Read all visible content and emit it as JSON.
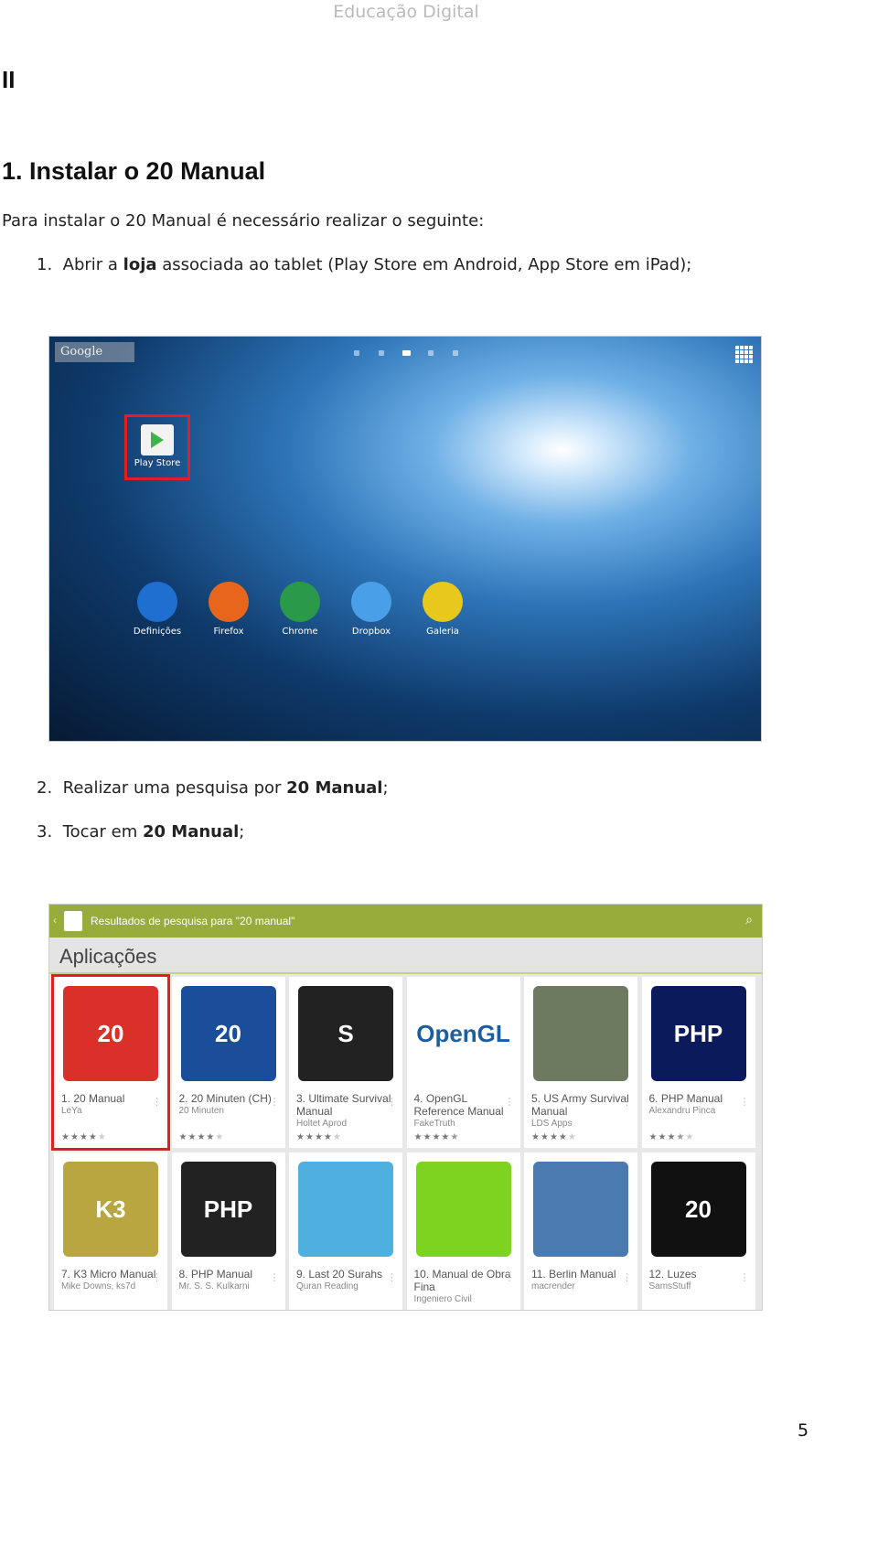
{
  "header": "Educação Digital",
  "section": "II",
  "title": "1. Instalar o 20 Manual",
  "intro": "Para instalar o 20 Manual é necessário realizar o seguinte:",
  "steps": [
    {
      "num": "1.",
      "pre": "Abrir a ",
      "bold": "loja",
      "post": " associada ao tablet (Play Store em Android, App Store em iPad);"
    },
    {
      "num": "2.",
      "pre": "Realizar uma pesquisa por ",
      "bold": "20 Manual",
      "post": ";"
    },
    {
      "num": "3.",
      "pre": "Tocar em ",
      "bold": "20 Manual",
      "post": ";"
    }
  ],
  "tablet": {
    "search": "Google",
    "highlight_color": "#e02020",
    "play_store": "Play Store",
    "apps": [
      {
        "label": "Definições",
        "color": "#1e6fd0"
      },
      {
        "label": "Firefox",
        "color": "#e8661c"
      },
      {
        "label": "Chrome",
        "color": "#2a9a4a"
      },
      {
        "label": "Dropbox",
        "color": "#4aa0e8"
      },
      {
        "label": "Galeria",
        "color": "#e8c81c"
      }
    ]
  },
  "store": {
    "bar_title": "Resultados de pesquisa para \"20 manual\"",
    "accent": "#97ac3a",
    "section": "Aplicações",
    "results": [
      {
        "title": "1. 20 Manual",
        "dev": "LeYa",
        "rating": 4,
        "icon": "20",
        "color": "#d9302a"
      },
      {
        "title": "2. 20 Minuten (CH)",
        "dev": "20 Minuten",
        "rating": 4,
        "icon": "20",
        "color": "#1a4e9a"
      },
      {
        "title": "3. Ultimate Survival Manual",
        "dev": "Holtet Aprod",
        "rating": 4,
        "icon": "S",
        "color": "#222"
      },
      {
        "title": "4. OpenGL Reference Manual",
        "dev": "FakeTruth",
        "rating": 4.5,
        "icon": "OpenGL",
        "color": "#ffffff"
      },
      {
        "title": "5. US Army Survival Manual",
        "dev": "LDS Apps",
        "rating": 4,
        "icon": "",
        "color": "#6d7a60"
      },
      {
        "title": "6. PHP Manual",
        "dev": "Alexandru Pinca",
        "rating": 3.5,
        "icon": "PHP",
        "color": "#0a1a5a"
      },
      {
        "title": "7. K3 Micro Manual",
        "dev": "Mike Downs, ks7d",
        "icon": "K3",
        "color": "#b9a640"
      },
      {
        "title": "8. PHP Manual",
        "dev": "Mr. S. S. Kulkarni",
        "icon": "PHP",
        "color": "#222"
      },
      {
        "title": "9. Last 20 Surahs",
        "dev": "Quran Reading",
        "icon": "",
        "color": "#4fb0e0"
      },
      {
        "title": "10. Manual de Obra Fina",
        "dev": "Ingeniero Civil",
        "icon": "",
        "color": "#7ed321"
      },
      {
        "title": "11. Berlin Manual",
        "dev": "macrender",
        "icon": "",
        "color": "#4a7ab0"
      },
      {
        "title": "12. Luzes",
        "dev": "SamsStuff",
        "icon": "20",
        "color": "#111"
      }
    ]
  },
  "page_number": "5"
}
